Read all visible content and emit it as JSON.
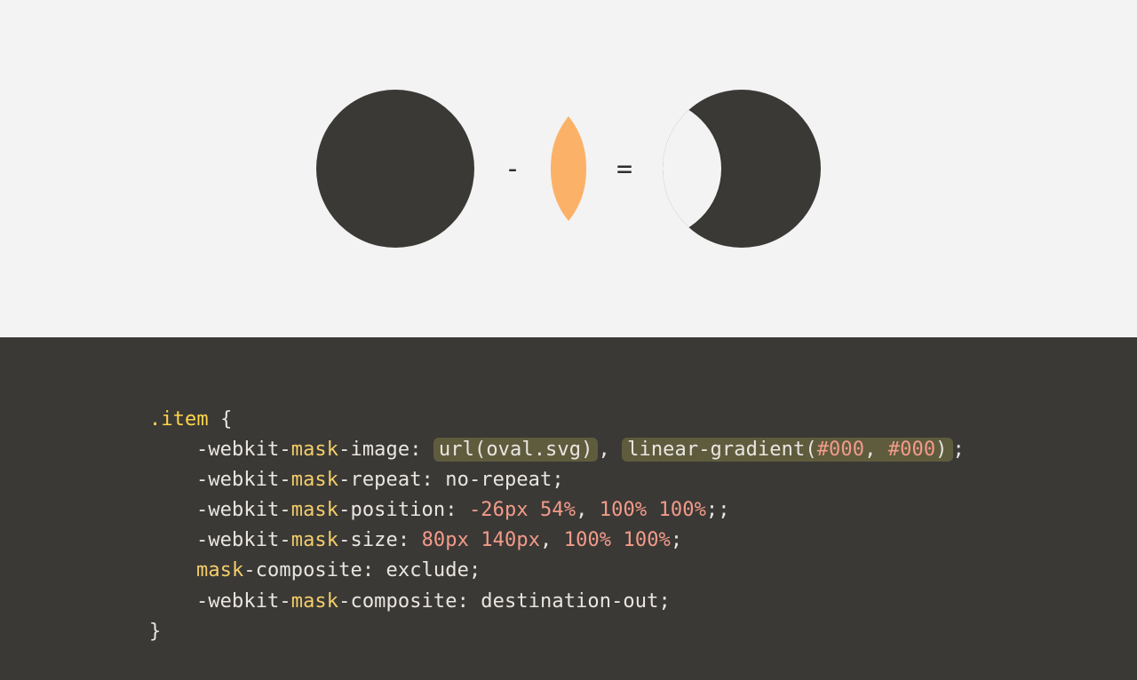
{
  "diagram": {
    "operator_minus": "-",
    "operator_equals": "=",
    "circle_color": "#3b3936",
    "oval_color": "#fbb268",
    "bg_color": "#f3f3f3"
  },
  "code": {
    "selector": ".item",
    "open_brace": "{",
    "close_brace": "}",
    "lines": {
      "l1": {
        "pre": "-webkit-",
        "key": "mask",
        "post": "-image",
        "colon": ": ",
        "url_label": "url",
        "url_lparen": "(",
        "url_arg": "oval.svg",
        "url_rparen": ")",
        "comma1": ", ",
        "grad_label": "linear-gradient",
        "grad_lparen": "(",
        "hex1": "#000",
        "grad_comma": ", ",
        "hex2": "#000",
        "grad_rparen": ")",
        "semi": ";"
      },
      "l2": {
        "pre": "-webkit-",
        "key": "mask",
        "post": "-repeat",
        "colon": ": ",
        "value": "no-repeat",
        "semi": ";"
      },
      "l3": {
        "pre": "-webkit-",
        "key": "mask",
        "post": "-position",
        "colon": ": ",
        "n1": "-26px",
        "sp1": " ",
        "n2": "54%",
        "comma": ", ",
        "n3": "100%",
        "sp2": " ",
        "n4": "100%",
        "semi": ";;"
      },
      "l4": {
        "pre": "-webkit-",
        "key": "mask",
        "post": "-size",
        "colon": ": ",
        "n1": "80px",
        "sp1": " ",
        "n2": "140px",
        "comma": ", ",
        "n3": "100%",
        "sp2": " ",
        "n4": "100%",
        "semi": ";"
      },
      "l5": {
        "key": "mask",
        "post": "-composite",
        "colon": ": ",
        "value": "exclude",
        "semi": ";"
      },
      "l6": {
        "pre": "-webkit-",
        "key": "mask",
        "post": "-composite",
        "colon": ": ",
        "value": "destination-out",
        "semi": ";"
      }
    }
  }
}
